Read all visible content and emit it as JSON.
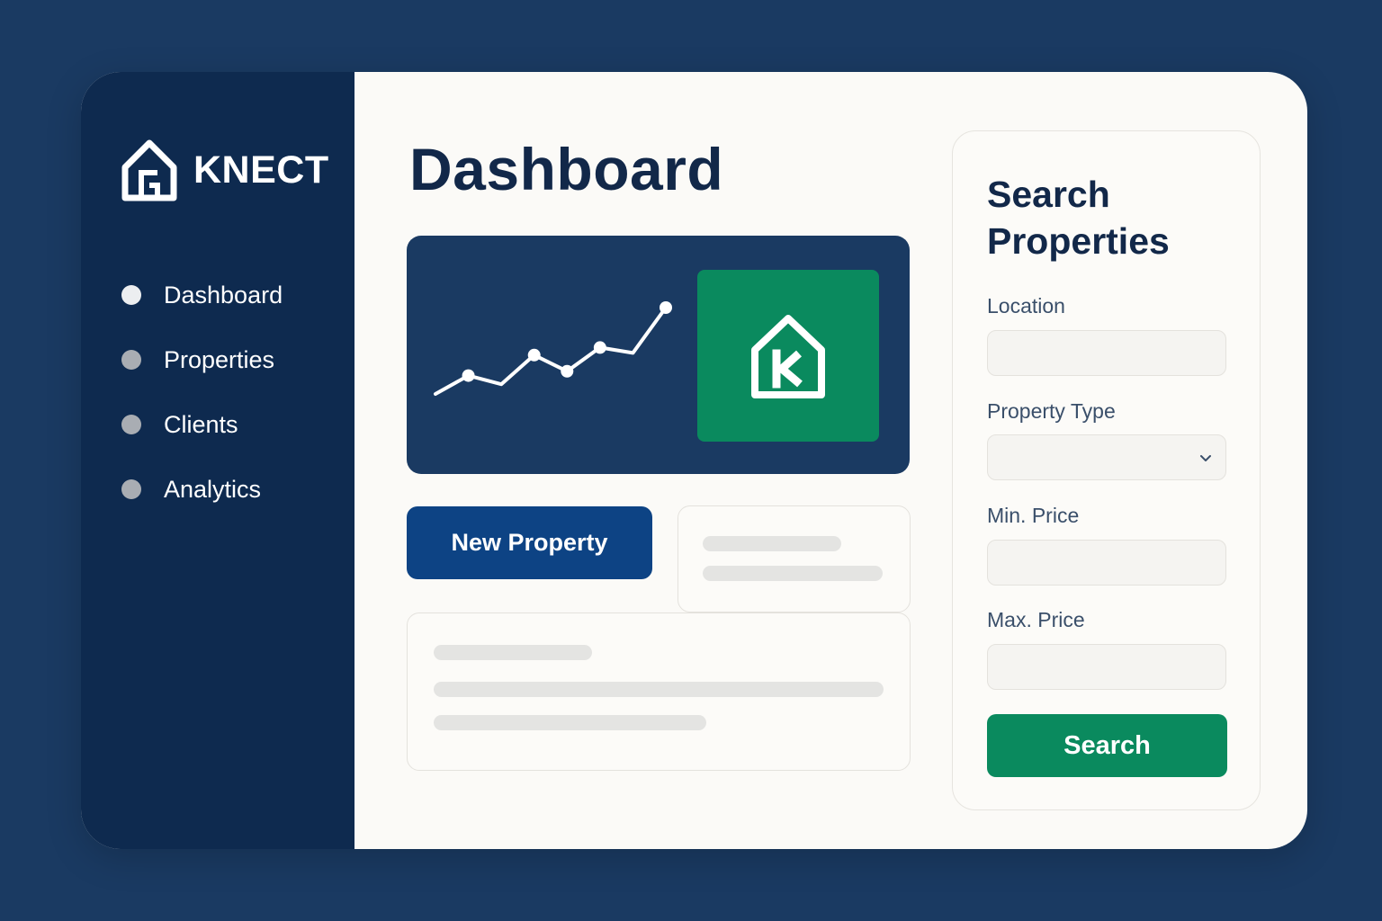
{
  "app": {
    "brand_name": "KNECT"
  },
  "sidebar": {
    "items": [
      {
        "label": "Dashboard",
        "active": true
      },
      {
        "label": "Properties",
        "active": false
      },
      {
        "label": "Clients",
        "active": false
      },
      {
        "label": "Analytics",
        "active": false
      }
    ]
  },
  "main": {
    "title": "Dashboard",
    "new_property_label": "New Property",
    "tile_icon": "house-k-icon",
    "chart_data": {
      "type": "line",
      "values": [
        20,
        37,
        29,
        56,
        41,
        63,
        58,
        100
      ]
    }
  },
  "search": {
    "title": "Search Properties",
    "fields": {
      "location": {
        "label": "Location",
        "value": ""
      },
      "property_type": {
        "label": "Property Type",
        "value": ""
      },
      "min_price": {
        "label": "Min. Price",
        "value": ""
      },
      "max_price": {
        "label": "Max. Price",
        "value": ""
      }
    },
    "button_label": "Search"
  },
  "colors": {
    "background": "#1a3a62",
    "sidebar": "#0e2a4f",
    "primary_button": "#0d4384",
    "accent_green": "#0a8a5e",
    "heading": "#122849"
  }
}
